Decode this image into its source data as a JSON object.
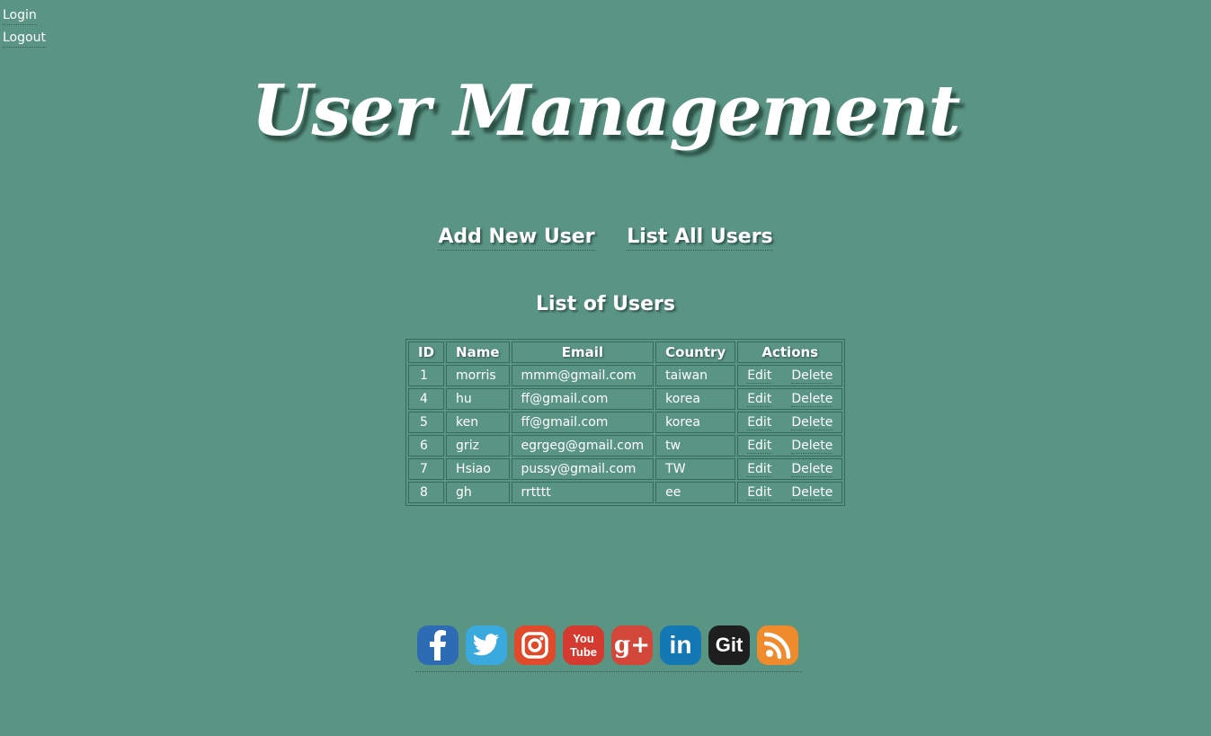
{
  "auth": {
    "login": "Login",
    "logout": "Logout"
  },
  "page_title": "User Management",
  "nav": {
    "add_new_user": "Add New User",
    "list_all_users": "List All Users"
  },
  "list_title": "List of Users",
  "table": {
    "headers": {
      "id": "ID",
      "name": "Name",
      "email": "Email",
      "country": "Country",
      "actions": "Actions"
    },
    "rows": [
      {
        "id": "1",
        "name": "morris",
        "email": "mmm@gmail.com",
        "country": "taiwan",
        "edit": "Edit",
        "delete": "Delete"
      },
      {
        "id": "4",
        "name": "hu",
        "email": "ff@gmail.com",
        "country": "korea",
        "edit": "Edit",
        "delete": "Delete"
      },
      {
        "id": "5",
        "name": "ken",
        "email": "ff@gmail.com",
        "country": "korea",
        "edit": "Edit",
        "delete": "Delete"
      },
      {
        "id": "6",
        "name": "griz",
        "email": "egrgeg@gmail.com",
        "country": "tw",
        "edit": "Edit",
        "delete": "Delete"
      },
      {
        "id": "7",
        "name": "Hsiao",
        "email": "pussy@gmail.com",
        "country": "TW",
        "edit": "Edit",
        "delete": "Delete"
      },
      {
        "id": "8",
        "name": "gh",
        "email": "rrtttt",
        "country": "ee",
        "edit": "Edit",
        "delete": "Delete"
      }
    ]
  },
  "social": [
    {
      "icon": "facebook-icon",
      "color": "#2d6cb5"
    },
    {
      "icon": "twitter-icon",
      "color": "#3aa9de"
    },
    {
      "icon": "instagram-icon",
      "color": "#e1492b"
    },
    {
      "icon": "youtube-icon",
      "color": "#d43a2f",
      "text": "You Tube"
    },
    {
      "icon": "google-plus-icon",
      "color": "#d3473a",
      "text": "g+"
    },
    {
      "icon": "linkedin-icon",
      "color": "#1478b4",
      "text": "in"
    },
    {
      "icon": "git-icon",
      "color": "#1e1e1e",
      "text": "Git"
    },
    {
      "icon": "rss-icon",
      "color": "#ef8b2c"
    }
  ],
  "colors": {
    "background": "#5a9483",
    "border": "#356b5b",
    "text": "#ffffff"
  }
}
